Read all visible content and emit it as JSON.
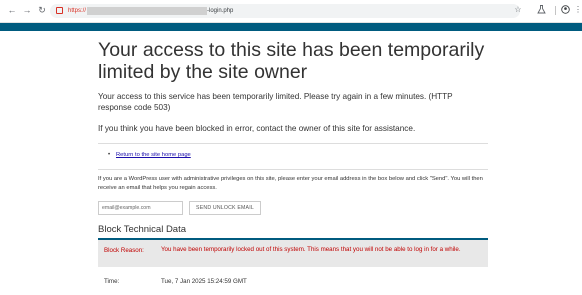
{
  "browser": {
    "url_scheme": "https://",
    "url_path": "-login.php"
  },
  "page": {
    "title": "Your access to this site has been temporarily limited by the site owner",
    "para1": "Your access to this service has been temporarily limited. Please try again in a few minutes. (HTTP response code 503)",
    "para2": "If you think you have been blocked in error, contact the owner of this site for assistance.",
    "return_link": "Return to the site home page",
    "para3": "If you are a WordPress user with administrative privileges on this site, please enter your email address in the box below and click \"Send\". You will then receive an email that helps you regain access.",
    "email_placeholder": "email@example.com",
    "send_button": "SEND UNLOCK EMAIL",
    "section_title": "Block Technical Data",
    "block_reason_label": "Block Reason:",
    "block_reason_value": "You have been temporarily locked out of this system. This means that you will not be able to log in for a while.",
    "time_label": "Time:",
    "time_value": "Tue, 7 Jan 2025 15:24:59 GMT"
  },
  "colors": {
    "accent": "#005b7f",
    "error_text": "#c00000",
    "link": "#1a0dab"
  },
  "icons": [
    "back-arrow-icon",
    "forward-arrow-icon",
    "reload-icon",
    "not-secure-icon",
    "star-icon",
    "extensions-icon",
    "profile-icon",
    "menu-icon"
  ]
}
